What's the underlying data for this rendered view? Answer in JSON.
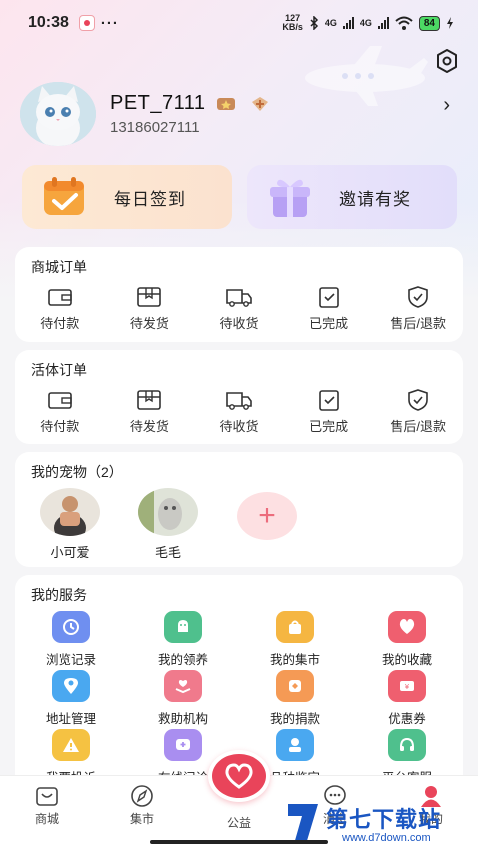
{
  "status_bar": {
    "time": "10:38",
    "more": "···",
    "speed_value": "127",
    "speed_unit": "KB/s",
    "net1": "4G",
    "net2": "4G",
    "battery": "84"
  },
  "profile": {
    "username": "PET_7111",
    "phone": "13186027111"
  },
  "cards": {
    "checkin": "每日签到",
    "invite": "邀请有奖"
  },
  "mall_orders": {
    "title": "商城订单",
    "items": [
      "待付款",
      "待发货",
      "待收货",
      "已完成",
      "售后/退款"
    ]
  },
  "live_orders": {
    "title": "活体订单",
    "items": [
      "待付款",
      "待发货",
      "待收货",
      "已完成",
      "售后/退款"
    ]
  },
  "pets": {
    "title": "我的宠物（2）",
    "items": [
      "小可爱",
      "毛毛"
    ]
  },
  "services": {
    "title": "我的服务",
    "items": [
      {
        "label": "浏览记录",
        "icon": "clock-icon",
        "color": "#6f8ff0"
      },
      {
        "label": "我的领养",
        "icon": "dog-icon",
        "color": "#4fc08d"
      },
      {
        "label": "我的集市",
        "icon": "bag-icon",
        "color": "#f5b642"
      },
      {
        "label": "我的收藏",
        "icon": "heart-icon",
        "color": "#ef5f6f"
      },
      {
        "label": "地址管理",
        "icon": "location-icon",
        "color": "#4aa8f0"
      },
      {
        "label": "救助机构",
        "icon": "hand-heart-icon",
        "color": "#f07a8c"
      },
      {
        "label": "我的捐款",
        "icon": "donation-icon",
        "color": "#f59a55"
      },
      {
        "label": "优惠券",
        "icon": "coupon-icon",
        "color": "#ef5f6f"
      },
      {
        "label": "我要投诉",
        "icon": "warning-icon",
        "color": "#f5c242"
      },
      {
        "label": "在线问诊",
        "icon": "chat-plus-icon",
        "color": "#a98ef0"
      },
      {
        "label": "品种鉴定",
        "icon": "identify-icon",
        "color": "#4aa8f0"
      },
      {
        "label": "平台客服",
        "icon": "headset-icon",
        "color": "#4fc08d"
      }
    ]
  },
  "nav": {
    "items": [
      "商城",
      "集市",
      "公益",
      "消息",
      "我的"
    ]
  },
  "watermark": {
    "text": "第七下载站",
    "url": "www.d7down.com"
  }
}
